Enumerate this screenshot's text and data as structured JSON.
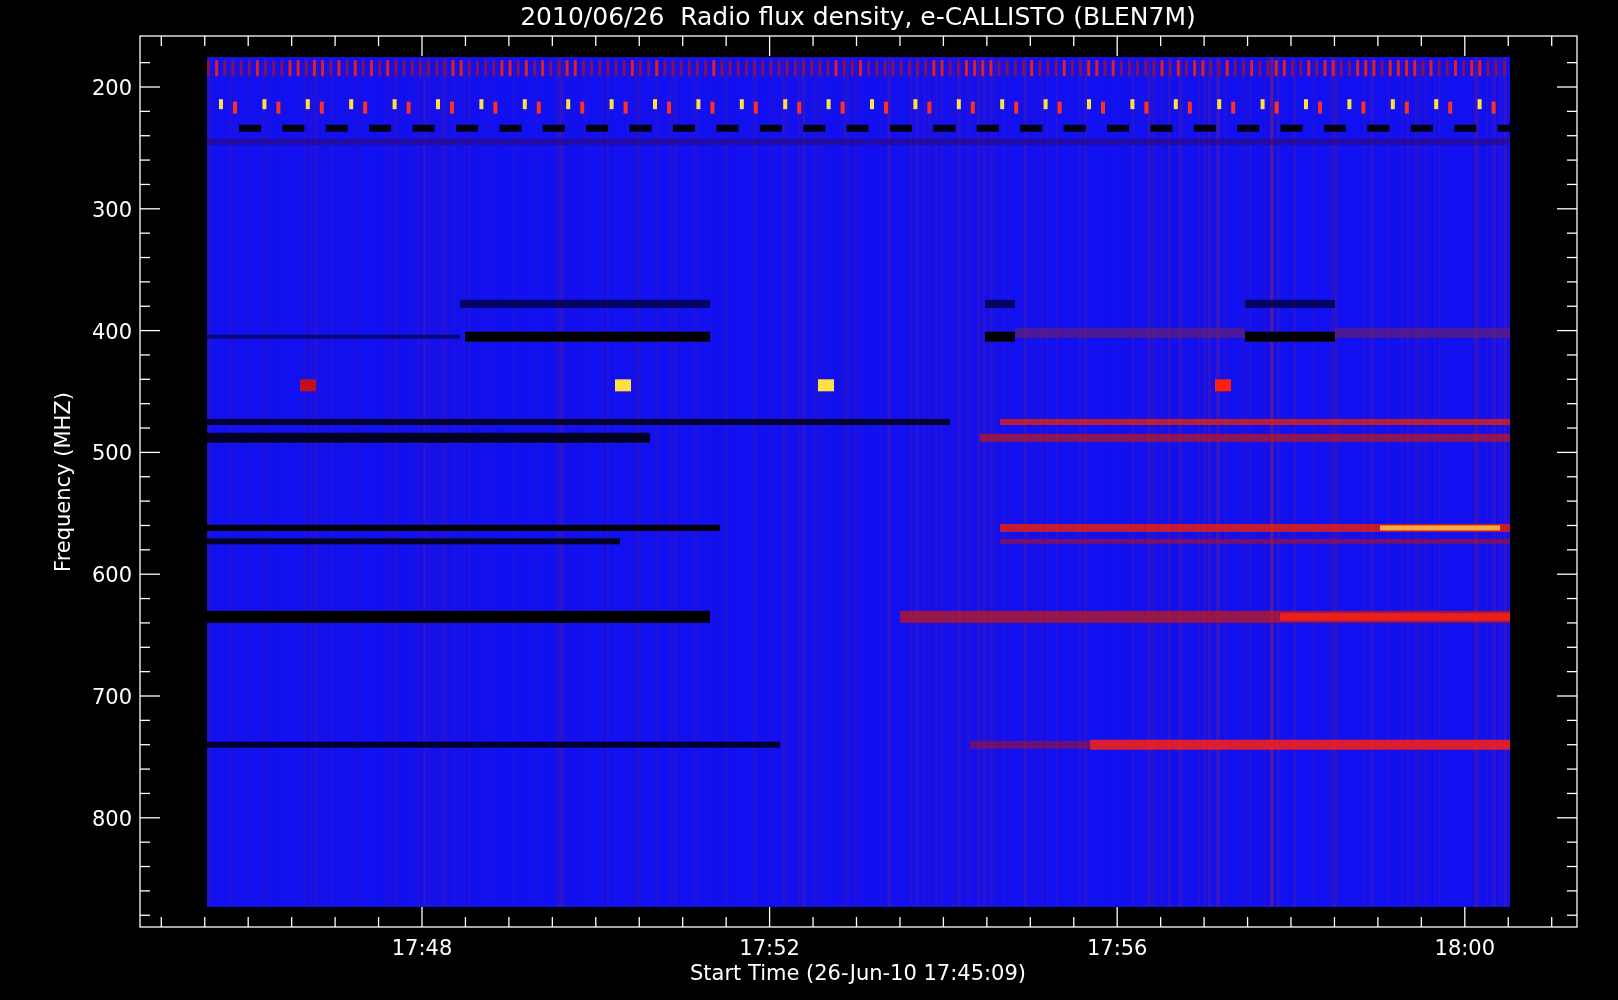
{
  "title": "2010/06/26  Radio flux density, e-CALLISTO (BLEN7M)",
  "y_axis": {
    "label": "Frequency (MHZ)",
    "ticks": [
      "200",
      "300",
      "400",
      "500",
      "600",
      "700",
      "800"
    ]
  },
  "x_axis": {
    "label": "Start Time (26-Jun-10 17:45:09)",
    "ticks": [
      "17:48",
      "17:52",
      "17:56",
      "18:00"
    ]
  }
}
